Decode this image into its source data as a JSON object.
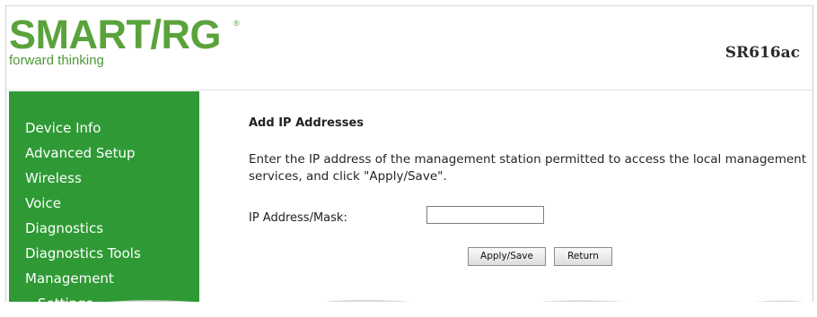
{
  "brand": {
    "logo_text": "SMART/RG",
    "registered_mark": "®",
    "tagline": "forward thinking",
    "model": "SR616ac",
    "brand_color": "#5aa33c"
  },
  "sidebar": {
    "background": "#2f9a35",
    "items": [
      {
        "label": "Device Info"
      },
      {
        "label": "Advanced Setup"
      },
      {
        "label": "Wireless"
      },
      {
        "label": "Voice"
      },
      {
        "label": "Diagnostics"
      },
      {
        "label": "Diagnostics Tools"
      },
      {
        "label": "Management"
      },
      {
        "label": "Settings"
      }
    ]
  },
  "main": {
    "title": "Add IP Addresses",
    "description": "Enter the IP address of the management station permitted to access the local management services, and click \"Apply/Save\".",
    "ip_field": {
      "label": "IP Address/Mask:",
      "value": ""
    },
    "buttons": {
      "apply_save": "Apply/Save",
      "return": "Return"
    }
  }
}
